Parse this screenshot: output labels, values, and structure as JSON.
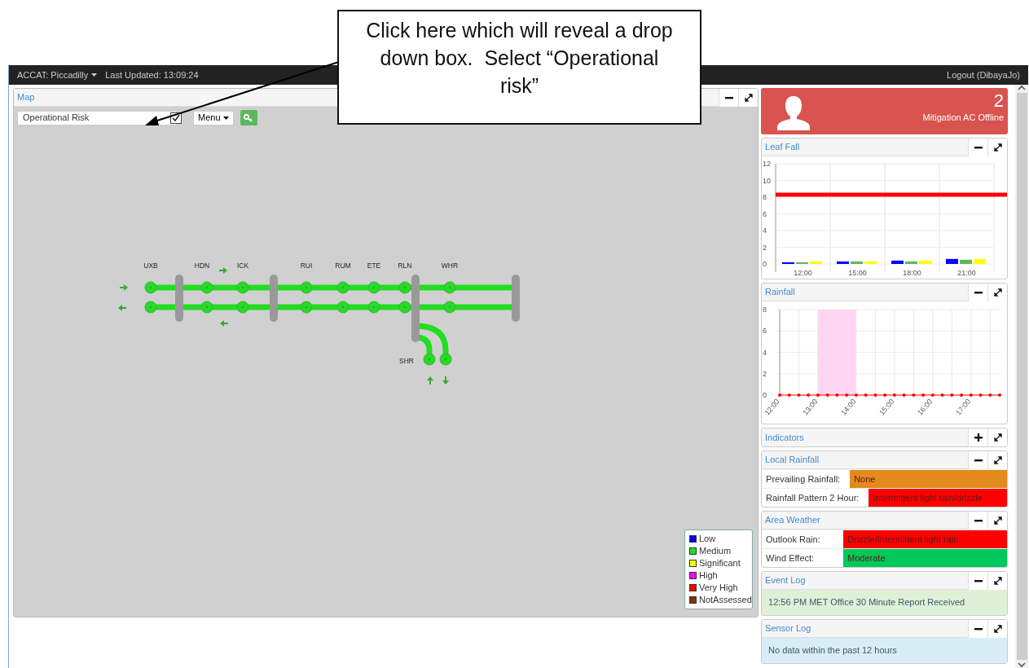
{
  "callout": {
    "text": "Click here which will reveal a drop down box.  Select “Operational risk”"
  },
  "navbar": {
    "site": "ACCAT: Piccadilly",
    "last_updated": "Last Updated: 13:09:24",
    "logout": "Logout (DibayaJo)"
  },
  "map": {
    "title": "Map",
    "layer_select": "Operational Risk",
    "layer_checked": true,
    "menu": "Menu",
    "stations": [
      "UXB",
      "HDN",
      "ICK",
      "RUI",
      "RUM",
      "ETE",
      "RLN",
      "WHR"
    ],
    "branch_station": "SHR",
    "legend": [
      {
        "label": "Low",
        "color": "#0000ff"
      },
      {
        "label": "Medium",
        "color": "#22dd22"
      },
      {
        "label": "Significant",
        "color": "#ffff00"
      },
      {
        "label": "High",
        "color": "#ff00ff"
      },
      {
        "label": "Very High",
        "color": "#ff0000"
      },
      {
        "label": "NotAssessed",
        "color": "#8b3000"
      }
    ]
  },
  "alert": {
    "count": "2",
    "message": "Mitigation AC Offline"
  },
  "widgets": [
    {
      "title": "Leaf Fall",
      "kind": "chart",
      "collapsed": false,
      "chart_data": {
        "type": "bar",
        "categories": [
          "12:00",
          "15:00",
          "18:00",
          "21:00"
        ],
        "ylim": [
          0,
          12
        ],
        "yticks": [
          0,
          2,
          4,
          6,
          8,
          10,
          12
        ],
        "series": [
          {
            "color": "#0000ff",
            "values": [
              0.2,
              0.3,
              0.4,
              0.6
            ]
          },
          {
            "color": "#5cb85c",
            "values": [
              0.2,
              0.3,
              0.3,
              0.5
            ]
          },
          {
            "color": "#ffff00",
            "values": [
              0.3,
              0.3,
              0.4,
              0.6
            ]
          }
        ],
        "grid": true,
        "ref_lines": [
          {
            "axis": "y",
            "value": 8.3,
            "color": "#ff0000"
          }
        ]
      }
    },
    {
      "title": "Rainfall",
      "kind": "chart",
      "collapsed": false,
      "chart_data": {
        "type": "line",
        "x": [
          12,
          12.25,
          12.5,
          12.75,
          13,
          13.25,
          13.5,
          13.75,
          14,
          14.25,
          14.5,
          14.75,
          15,
          15.25,
          15.5,
          15.75,
          16,
          16.25,
          16.5,
          16.75,
          17,
          17.25,
          17.5,
          17.75
        ],
        "xlim": [
          12,
          17.75
        ],
        "ylim": [
          0,
          8
        ],
        "yticks": [
          0,
          2,
          4,
          6,
          8
        ],
        "xticks": [
          {
            "value": 12,
            "label": "12:00"
          },
          {
            "value": 13,
            "label": "13:00"
          },
          {
            "value": 14,
            "label": "14:00"
          },
          {
            "value": 15,
            "label": "15:00"
          },
          {
            "value": 16,
            "label": "16:00"
          },
          {
            "value": 17,
            "label": "17:00"
          }
        ],
        "series": [
          {
            "color": "#ff0000",
            "values": [
              0,
              0,
              0,
              0,
              0,
              0,
              0,
              0,
              0,
              0,
              0,
              0,
              0,
              0,
              0,
              0,
              0,
              0,
              0,
              0,
              0,
              0,
              0,
              0
            ]
          }
        ],
        "grid": true,
        "bands": [
          {
            "axis": "x",
            "from": 13,
            "to": 14,
            "color": "#ffd6f3"
          }
        ]
      }
    },
    {
      "title": "Indicators",
      "collapsed": true
    },
    {
      "title": "Local Rainfall",
      "kind": "table",
      "collapsed": false,
      "rows": [
        {
          "label": "Prevailing Rainfall:",
          "value": "None",
          "color": "#e38a1d"
        },
        {
          "label": "Rainfall Pattern 2 Hour:",
          "value": "Intermittent light rain/drizzle",
          "color": "#ff0000"
        }
      ]
    },
    {
      "title": "Area Weather",
      "kind": "table",
      "collapsed": false,
      "rows": [
        {
          "label": "Outlook Rain:",
          "value": "Drizzle/Intermittent light rain",
          "color": "#ff0000"
        },
        {
          "label": "Wind Effect:",
          "value": "Moderate",
          "color": "#00c85a"
        }
      ]
    },
    {
      "title": "Event Log",
      "kind": "log",
      "collapsed": false,
      "color": "#dff0d8",
      "message": "12:56 PM MET Office 30 Minute Report Received"
    },
    {
      "title": "Sensor Log",
      "kind": "log",
      "collapsed": false,
      "color": "#d9edf7",
      "message": "No data within the past 12 hours"
    }
  ]
}
